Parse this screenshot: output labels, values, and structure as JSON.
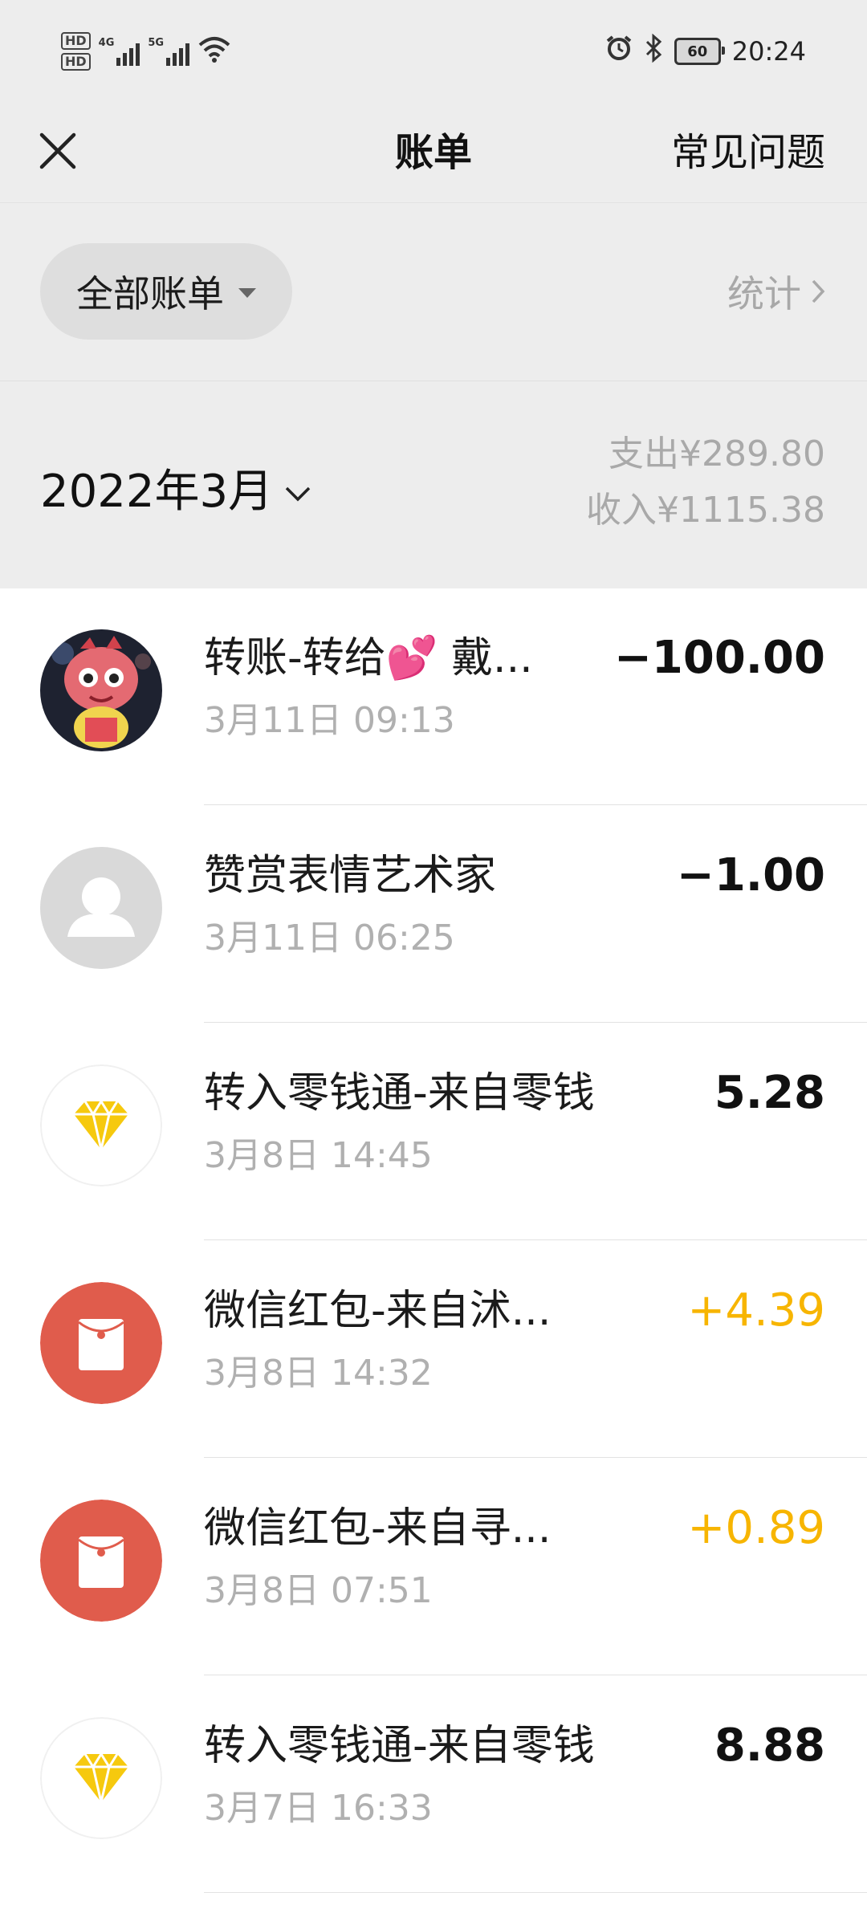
{
  "status_bar": {
    "hd1": "HD",
    "hd2": "HD",
    "net1": "4G",
    "net2": "5G",
    "battery": "60",
    "time": "20:24",
    "icons": [
      "wifi-icon",
      "alarm-icon",
      "bluetooth-icon",
      "battery-icon"
    ]
  },
  "nav": {
    "title": "账单",
    "faq": "常见问题",
    "close_icon": "close-icon"
  },
  "filter": {
    "label": "全部账单",
    "stats": "统计"
  },
  "month": {
    "label": "2022年3月",
    "expense": "支出¥289.80",
    "income": "收入¥1115.38"
  },
  "transactions": [
    {
      "title": "转账-转给💕 戴...",
      "time": "3月11日 09:13",
      "amount": "−100.00",
      "type": "expense",
      "avatar": "user-photo-avatar"
    },
    {
      "title": "赞赏表情艺术家",
      "time": "3月11日 06:25",
      "amount": "−1.00",
      "type": "expense",
      "avatar": "default-user-avatar"
    },
    {
      "title": "转入零钱通-来自零钱",
      "time": "3月8日 14:45",
      "amount": "5.28",
      "type": "neutral",
      "avatar": "diamond-icon"
    },
    {
      "title": "微信红包-来自沭...",
      "time": "3月8日 14:32",
      "amount": "+4.39",
      "type": "income",
      "avatar": "red-packet-icon"
    },
    {
      "title": "微信红包-来自寻...",
      "time": "3月8日 07:51",
      "amount": "+0.89",
      "type": "income",
      "avatar": "red-packet-icon"
    },
    {
      "title": "转入零钱通-来自零钱",
      "time": "3月7日 16:33",
      "amount": "8.88",
      "type": "neutral",
      "avatar": "diamond-icon"
    }
  ],
  "colors": {
    "header_bg": "#ededed",
    "income": "#f7b500",
    "red_packet": "#e05c4c",
    "diamond": "#f6c90e"
  }
}
